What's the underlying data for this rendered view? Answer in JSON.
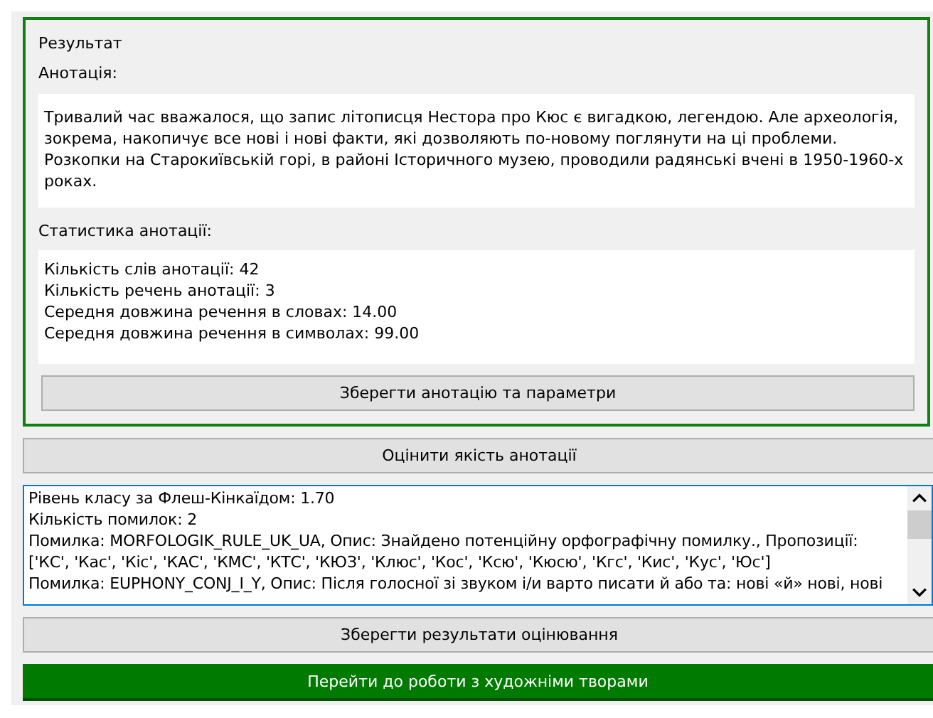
{
  "group": {
    "title": "Результат",
    "annotation_label": "Анотація:",
    "annotation_text": "Тривалий час вважалося, що запис літописця Нестора про Кюс є вигадкою, легендою. Але археологія, зокрема, накопичує все нові і нові факти, які дозволяють по-новому поглянути на ці проблеми. Розкопки на Старокиївській горі, в районі Історичного музею, проводили радянські вчені в 1950-1960-х роках.",
    "stats_label": "Статистика анотації:",
    "stats_lines": [
      "Кількість слів анотації: 42",
      "Кількість речень анотації: 3",
      "Середня довжина речення в словах: 14.00",
      "Середня довжина речення в символах: 99.00"
    ],
    "save_button": "Зберегти анотацію та параметри"
  },
  "evaluate_button": "Оцінити якість анотації",
  "results_lines": [
    "Рівень класу за Флеш-Кінкаїдом: 1.70",
    "Кількість помилок: 2",
    "Помилка: MORFOLOGIK_RULE_UK_UA, Опис: Знайдено потенційну орфографічну помилку., Пропозиції: ['КС', 'Кас', 'Кіс', 'КАС', 'КМС', 'КТС', 'КЮЗ', 'Клюс', 'Кос', 'Ксю', 'Кюсю', 'Кгс', 'Кис', 'Кус', 'Юс']",
    "Помилка: EUPHONY_CONJ_I_Y, Опис: Після голосної зі звуком і/и варто писати й або та: нові «й» нові, нові"
  ],
  "save_results_button": "Зберегти результати оцінювання",
  "navigate_button": "Перейти до роботи з художніми творами"
}
